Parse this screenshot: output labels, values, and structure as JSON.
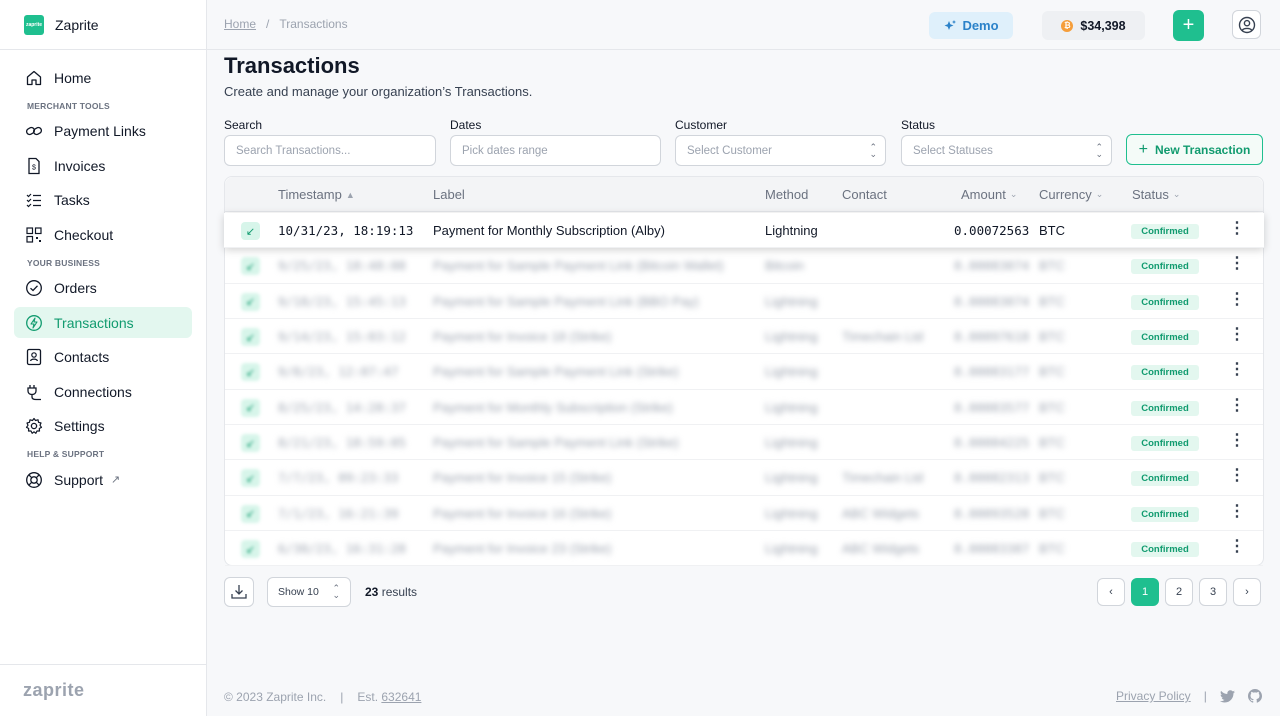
{
  "brand": {
    "name": "Zaprite",
    "logo_text": "zaprite",
    "footer_logo": "zaprite"
  },
  "sidebar": {
    "items": [
      {
        "label": "Home",
        "icon": "home-icon"
      },
      {
        "section": "MERCHANT TOOLS"
      },
      {
        "label": "Payment Links",
        "icon": "link-icon"
      },
      {
        "label": "Invoices",
        "icon": "invoice-icon"
      },
      {
        "label": "Tasks",
        "icon": "tasks-icon"
      },
      {
        "label": "Checkout",
        "icon": "qr-icon"
      },
      {
        "section": "YOUR BUSINESS"
      },
      {
        "label": "Orders",
        "icon": "check-circle-icon"
      },
      {
        "label": "Transactions",
        "icon": "bolt-circle-icon",
        "active": true
      },
      {
        "label": "Contacts",
        "icon": "contact-card-icon"
      },
      {
        "label": "Connections",
        "icon": "plug-icon"
      },
      {
        "label": "Settings",
        "icon": "gear-icon"
      },
      {
        "section": "HELP & SUPPORT"
      },
      {
        "label": "Support",
        "icon": "lifebuoy-icon",
        "external": true
      }
    ]
  },
  "topbar": {
    "breadcrumb": [
      "Home",
      "Transactions"
    ],
    "breadcrumb_sep": "/",
    "demo_label": "Demo",
    "balance": "$34,398",
    "btc_symbol": "₿",
    "add_symbol": "+"
  },
  "page": {
    "title": "Transactions",
    "subtitle": "Create and manage your organization’s Transactions."
  },
  "filters": {
    "search": {
      "label": "Search",
      "placeholder": "Search Transactions..."
    },
    "dates": {
      "label": "Dates",
      "placeholder": "Pick dates range"
    },
    "customer": {
      "label": "Customer",
      "placeholder": "Select Customer"
    },
    "status": {
      "label": "Status",
      "placeholder": "Select Statuses"
    },
    "new_button": "New Transaction"
  },
  "table": {
    "columns": [
      "Timestamp",
      "Label",
      "Method",
      "Contact",
      "Amount",
      "Currency",
      "Status"
    ],
    "rows": [
      {
        "timestamp": "10/31/23, 18:19:13",
        "label": "Payment for Monthly Subscription (Alby)",
        "method": "Lightning",
        "contact": "",
        "amount": "0.00072563",
        "currency": "BTC",
        "status": "Confirmed"
      },
      {
        "timestamp": "9/25/23, 18:48:08",
        "label": "Payment for Sample Payment Link (Bitcoin Wallet)",
        "method": "Bitcoin",
        "contact": "",
        "amount": "0.00083074",
        "currency": "BTC",
        "status": "Confirmed"
      },
      {
        "timestamp": "9/18/23, 15:45:13",
        "label": "Payment for Sample Payment Link (BBO Pay)",
        "method": "Lightning",
        "contact": "",
        "amount": "0.00083074",
        "currency": "BTC",
        "status": "Confirmed"
      },
      {
        "timestamp": "9/14/23, 15:03:12",
        "label": "Payment for Invoice 18 (Strike)",
        "method": "Lightning",
        "contact": "Timechain Ltd",
        "amount": "0.00097618",
        "currency": "BTC",
        "status": "Confirmed"
      },
      {
        "timestamp": "9/8/23, 12:07:47",
        "label": "Payment for Sample Payment Link (Strike)",
        "method": "Lightning",
        "contact": "",
        "amount": "0.00083177",
        "currency": "BTC",
        "status": "Confirmed"
      },
      {
        "timestamp": "8/25/23, 14:28:37",
        "label": "Payment for Monthly Subscription (Strike)",
        "method": "Lightning",
        "contact": "",
        "amount": "0.00083577",
        "currency": "BTC",
        "status": "Confirmed"
      },
      {
        "timestamp": "8/21/23, 18:59:05",
        "label": "Payment for Sample Payment Link (Strike)",
        "method": "Lightning",
        "contact": "",
        "amount": "0.00084225",
        "currency": "BTC",
        "status": "Confirmed"
      },
      {
        "timestamp": "7/7/23, 09:23:33",
        "label": "Payment for Invoice 15 (Strike)",
        "method": "Lightning",
        "contact": "Timechain Ltd",
        "amount": "0.00082313",
        "currency": "BTC",
        "status": "Confirmed"
      },
      {
        "timestamp": "7/1/23, 16:21:39",
        "label": "Payment for Invoice 16 (Strike)",
        "method": "Lightning",
        "contact": "ABC Widgets",
        "amount": "0.00093528",
        "currency": "BTC",
        "status": "Confirmed"
      },
      {
        "timestamp": "6/30/23, 16:31:28",
        "label": "Payment for Invoice 23 (Strike)",
        "method": "Lightning",
        "contact": "ABC Widgets",
        "amount": "0.00083387",
        "currency": "BTC",
        "status": "Confirmed"
      }
    ]
  },
  "pagination": {
    "show_label": "Show 10",
    "results_count": "23",
    "results_label": "results",
    "pages": [
      "1",
      "2",
      "3"
    ],
    "current_page": "1",
    "prev": "‹",
    "next": "›"
  },
  "footer": {
    "copyright": "© 2023 Zaprite Inc.",
    "sep": "|",
    "est_label": "Est.",
    "est_value": "632641",
    "privacy": "Privacy Policy"
  },
  "colors": {
    "accent": "#1fbf8f",
    "accent_dark": "#119b6f",
    "demo": "#2b82c9",
    "btc": "#f59e3b"
  }
}
